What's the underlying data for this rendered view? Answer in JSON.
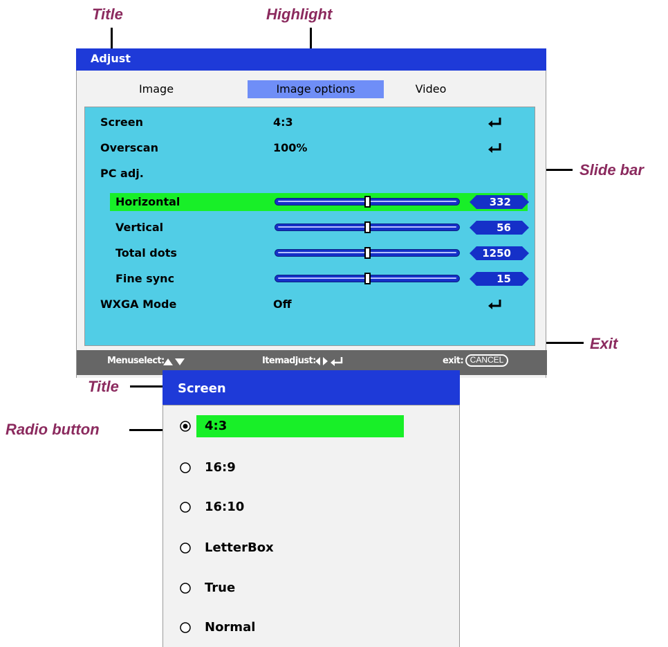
{
  "callouts": {
    "title_top": "Title",
    "highlight": "Highlight",
    "slide_bar": "Slide bar",
    "exit": "Exit",
    "title_screen": "Title",
    "radio_button": "Radio button"
  },
  "adjust": {
    "title": "Adjust",
    "tabs": [
      "Image",
      "Image options",
      "Video"
    ],
    "active_tab": "Image options",
    "rows": [
      {
        "label": "Screen",
        "value": "4:3"
      },
      {
        "label": "Overscan",
        "value": "100%"
      },
      {
        "label": "PC adj.",
        "value": ""
      },
      {
        "label": "Horizontal",
        "value": "332"
      },
      {
        "label": "Vertical",
        "value": "56"
      },
      {
        "label": "Total dots",
        "value": "1250"
      },
      {
        "label": "Fine sync",
        "value": "15"
      },
      {
        "label": "WXGA Mode",
        "value": "Off"
      }
    ],
    "status": {
      "menu_select": "Menuselect:",
      "item_adjust": "Itemadjust:",
      "exit": "exit:",
      "cancel": "CANCEL"
    }
  },
  "screen_window": {
    "title": "Screen",
    "options": [
      "4:3",
      "16:9",
      "16:10",
      "LetterBox",
      "True",
      "Normal"
    ],
    "selected": "4:3"
  },
  "colors": {
    "title_bar": "#1e3ad8",
    "panel": "#51cde6",
    "highlight": "#18ef28",
    "active_tab": "#6f8ef7",
    "callout_text": "#8b2a5e"
  }
}
